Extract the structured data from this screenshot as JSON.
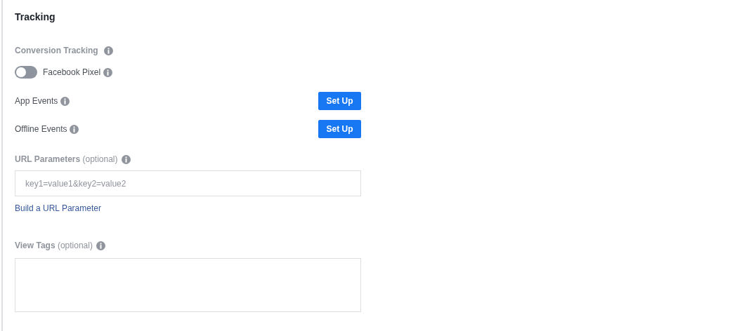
{
  "section": {
    "title": "Tracking"
  },
  "conversion_tracking": {
    "heading": "Conversion Tracking",
    "pixel": {
      "label": "Facebook Pixel",
      "on": false
    },
    "events": [
      {
        "label": "App Events",
        "button": "Set Up"
      },
      {
        "label": "Offline Events",
        "button": "Set Up"
      }
    ]
  },
  "url_parameters": {
    "label": "**URL Parameters** (optional)",
    "placeholder": "key1=value1&key2=value2",
    "link": "Build a URL Parameter"
  },
  "view_tags": {
    "label": "**View Tags** (optional)"
  }
}
